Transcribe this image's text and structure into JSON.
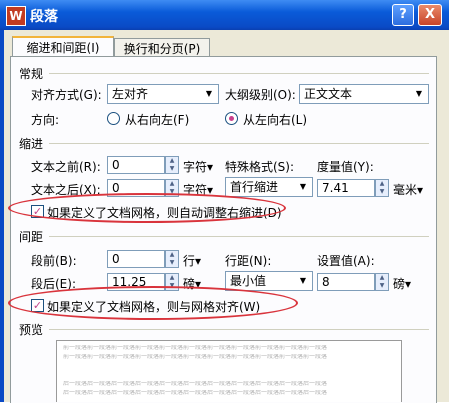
{
  "window": {
    "title": "段落",
    "app_icon_letter": "W",
    "help_label": "?",
    "close_label": "X"
  },
  "tabs": [
    {
      "label": "缩进和间距(I)"
    },
    {
      "label": "换行和分页(P)"
    }
  ],
  "general": {
    "heading": "常规",
    "alignment_label": "对齐方式(G):",
    "alignment_value": "左对齐",
    "outline_label": "大纲级别(O):",
    "outline_value": "正文文本",
    "direction_label": "方向:",
    "direction_rtl": "从右向左(F)",
    "direction_ltr": "从左向右(L)"
  },
  "indent": {
    "heading": "缩进",
    "before_label": "文本之前(R):",
    "before_value": "0",
    "before_unit": "字符▾",
    "after_label": "文本之后(X):",
    "after_value": "0",
    "after_unit": "字符▾",
    "special_label": "特殊格式(S):",
    "special_value": "首行缩进",
    "measure_label": "度量值(Y):",
    "measure_value": "7.41",
    "measure_unit": "毫米▾",
    "grid_check_label": "如果定义了文档网格，则自动调整右缩进(D)"
  },
  "spacing": {
    "heading": "间距",
    "before_label": "段前(B):",
    "before_value": "0",
    "before_unit": "行▾",
    "after_label": "段后(E):",
    "after_value": "11.25",
    "after_unit": "磅▾",
    "line_label": "行距(N):",
    "line_value": "最小值",
    "setting_label": "设置值(A):",
    "setting_value": "8",
    "setting_unit": "磅▾",
    "grid_check_label": "如果定义了文档网格，则与网格对齐(W)"
  },
  "preview": {
    "heading": "预览",
    "lines": [
      "前一段落前一段落前一段落前一段落前一段落前一段落前一段落前一段落前一段落前一段落前一段落",
      "前一段落前一段落前一段落前一段落前一段落前一段落前一段落前一段落前一段落前一段落前一段落",
      "后一段落后一段落后一段落后一段落后一段落后一段落后一段落后一段落后一段落后一段落后一段落",
      "后一段落后一段落后一段落后一段落后一段落后一段落后一段落后一段落后一段落后一段落后一段落"
    ]
  },
  "colors": {
    "title_bar": "#0a4ac5",
    "dialog_bg": "#ece9d8",
    "highlight_ellipse": "#d9343c",
    "radio_dot": "#c8408d"
  }
}
